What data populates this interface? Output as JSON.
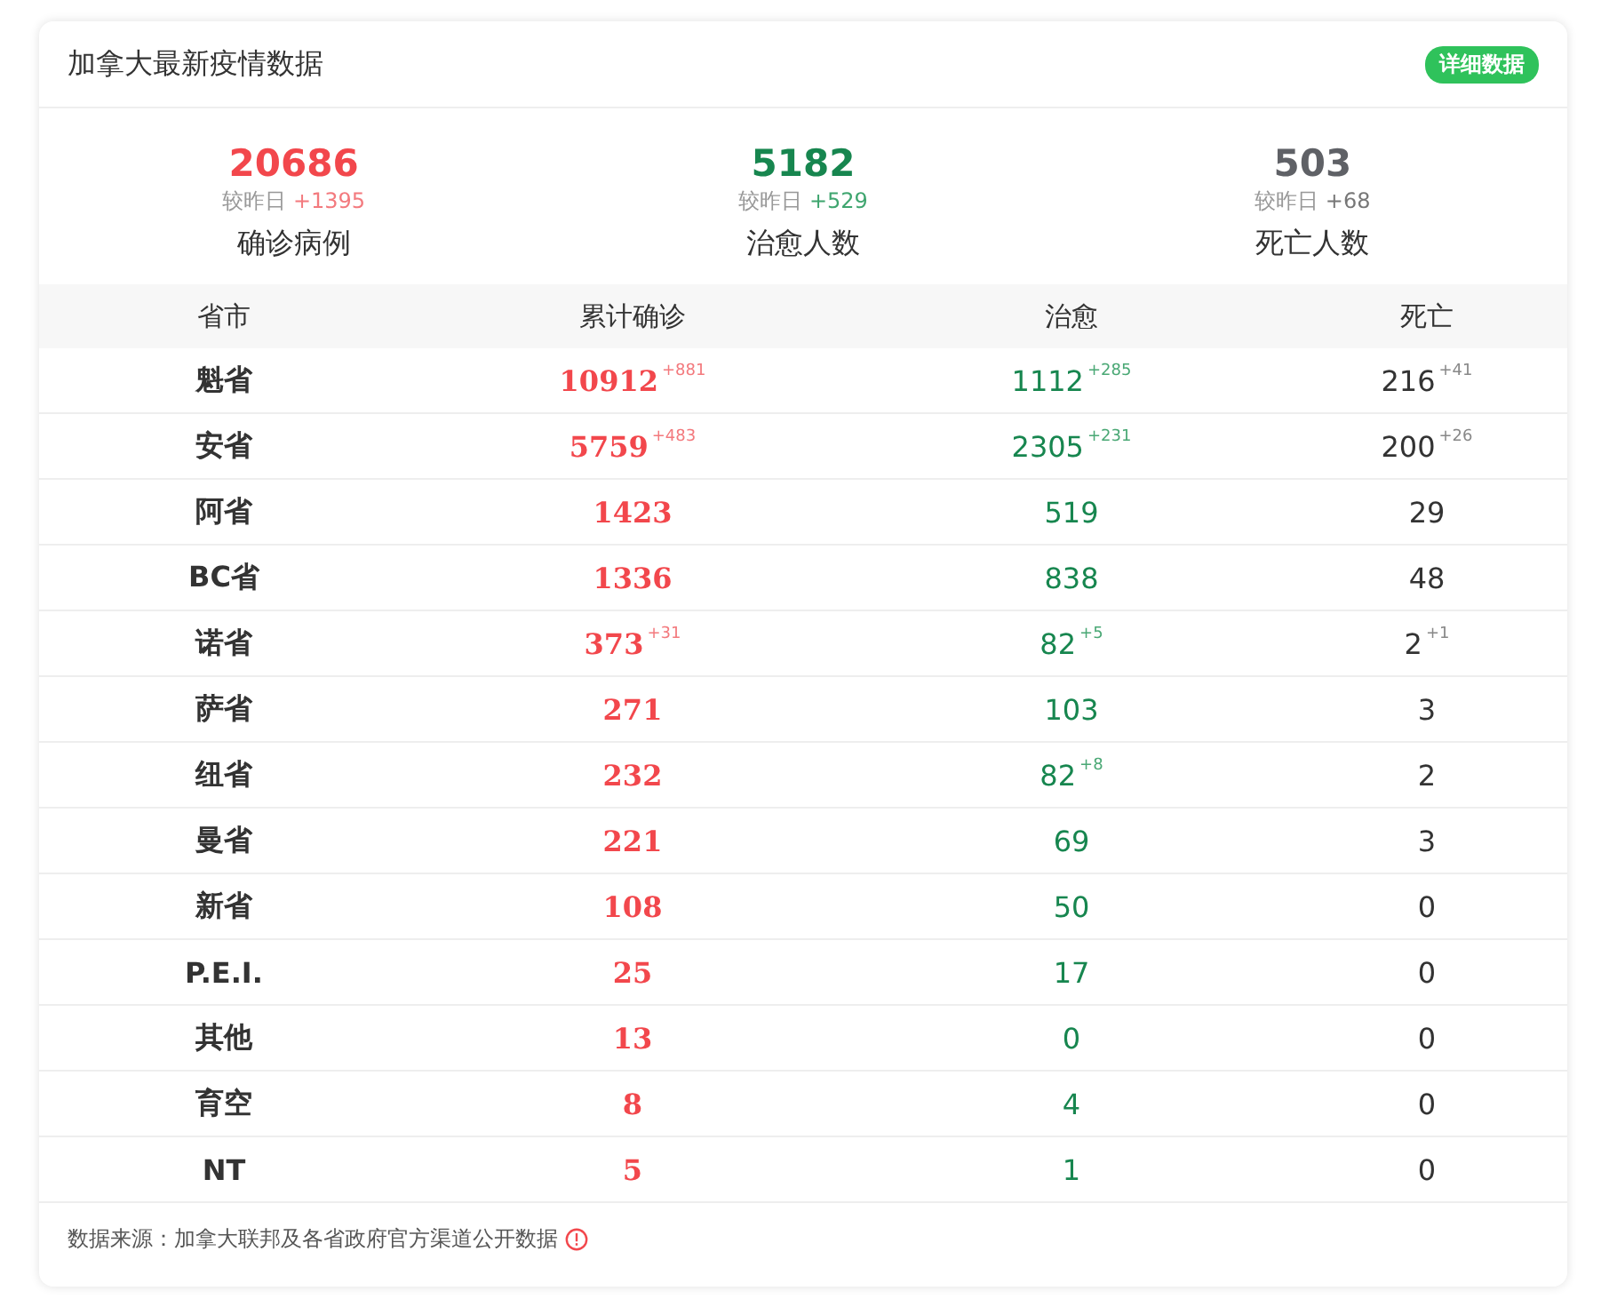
{
  "header": {
    "title": "加拿大最新疫情数据",
    "detail_button": "详细数据"
  },
  "stats": [
    {
      "kind": "confirmed",
      "value": "20686",
      "compare_label": "较昨日",
      "delta": "+1395",
      "label": "确诊病例"
    },
    {
      "kind": "cured",
      "value": "5182",
      "compare_label": "较昨日",
      "delta": "+529",
      "label": "治愈人数"
    },
    {
      "kind": "deaths",
      "value": "503",
      "compare_label": "较昨日",
      "delta": "+68",
      "label": "死亡人数"
    }
  ],
  "table": {
    "columns": [
      "省市",
      "累计确诊",
      "治愈",
      "死亡"
    ],
    "rows": [
      {
        "province": "魁省",
        "confirmed": "10912",
        "confirmed_delta": "+881",
        "cured": "1112",
        "cured_delta": "+285",
        "deaths": "216",
        "deaths_delta": "+41"
      },
      {
        "province": "安省",
        "confirmed": "5759",
        "confirmed_delta": "+483",
        "cured": "2305",
        "cured_delta": "+231",
        "deaths": "200",
        "deaths_delta": "+26"
      },
      {
        "province": "阿省",
        "confirmed": "1423",
        "cured": "519",
        "deaths": "29"
      },
      {
        "province": "BC省",
        "confirmed": "1336",
        "cured": "838",
        "deaths": "48"
      },
      {
        "province": "诺省",
        "confirmed": "373",
        "confirmed_delta": "+31",
        "cured": "82",
        "cured_delta": "+5",
        "deaths": "2",
        "deaths_delta": "+1"
      },
      {
        "province": "萨省",
        "confirmed": "271",
        "cured": "103",
        "deaths": "3"
      },
      {
        "province": "纽省",
        "confirmed": "232",
        "cured": "82",
        "cured_delta": "+8",
        "deaths": "2"
      },
      {
        "province": "曼省",
        "confirmed": "221",
        "cured": "69",
        "deaths": "3"
      },
      {
        "province": "新省",
        "confirmed": "108",
        "cured": "50",
        "deaths": "0"
      },
      {
        "province": "P.E.I.",
        "confirmed": "25",
        "cured": "17",
        "deaths": "0"
      },
      {
        "province": "其他",
        "confirmed": "13",
        "cured": "0",
        "deaths": "0"
      },
      {
        "province": "育空",
        "confirmed": "8",
        "cured": "4",
        "deaths": "0"
      },
      {
        "province": "NT",
        "confirmed": "5",
        "cured": "1",
        "deaths": "0"
      }
    ]
  },
  "footer": {
    "source": "数据来源：加拿大联邦及各省政府官方渠道公开数据"
  }
}
